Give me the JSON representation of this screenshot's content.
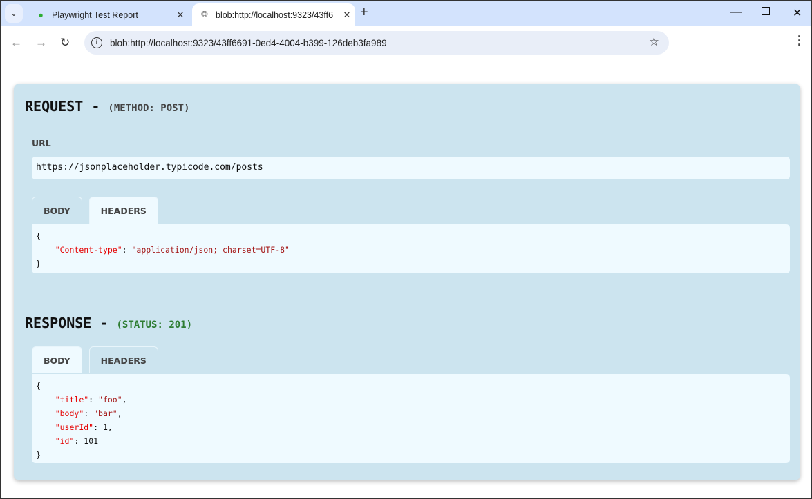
{
  "browser": {
    "tabs": [
      {
        "title": "Playwright Test Report",
        "icon": "playwright-icon"
      },
      {
        "title": "blob:http://localhost:9323/43ff6",
        "icon": "globe-icon",
        "active": true
      }
    ],
    "url": "blob:http://localhost:9323/43ff6691-0ed4-4004-b399-126deb3fa989"
  },
  "request": {
    "title": "REQUEST -",
    "method": "(METHOD: POST)",
    "url_label": "URL",
    "url": "https://jsonplaceholder.typicode.com/posts",
    "tabs": [
      "BODY",
      "HEADERS"
    ],
    "active_tab": "HEADERS",
    "headers": [
      {
        "key": "\"Content-type\"",
        "value": "\"application/json; charset=UTF-8\""
      }
    ]
  },
  "response": {
    "title": "RESPONSE -",
    "status": "(STATUS: 201)",
    "status_color": "#2e7d32",
    "tabs": [
      "BODY",
      "HEADERS"
    ],
    "active_tab": "BODY",
    "body": [
      {
        "key": "\"title\"",
        "value": "\"foo\"",
        "sep": ","
      },
      {
        "key": "\"body\"",
        "value": "\"bar\"",
        "sep": ","
      },
      {
        "key": "\"userId\"",
        "value": "1",
        "sep": ","
      },
      {
        "key": "\"id\"",
        "value": "101",
        "sep": ""
      }
    ]
  },
  "json": {
    "open": "{",
    "close": "}",
    "colon": ": "
  }
}
